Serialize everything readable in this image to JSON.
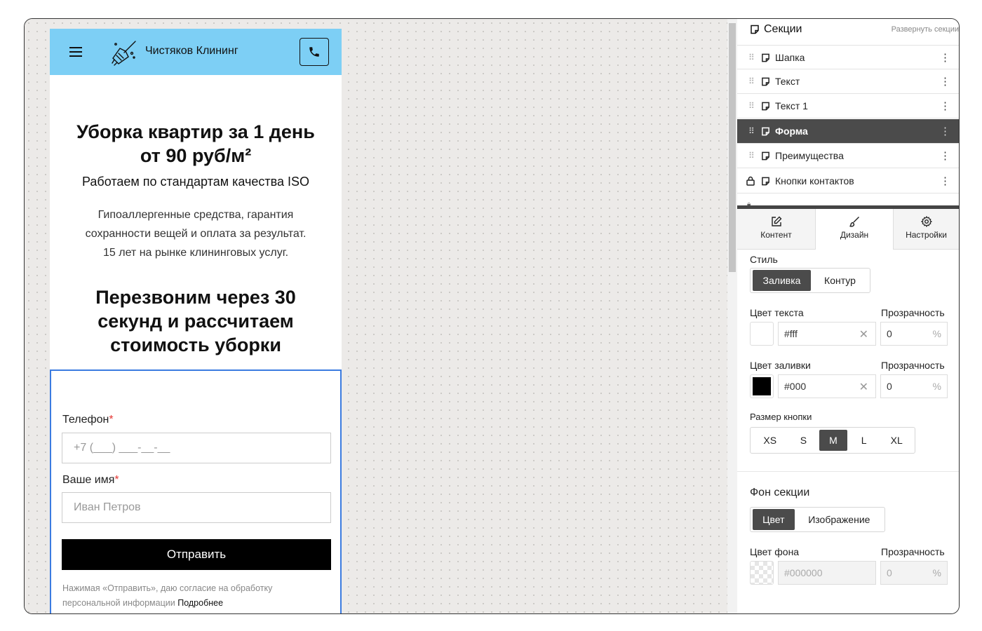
{
  "preview": {
    "brand": "Чистяков Клининг",
    "headline_line1": "Уборка квартир за 1 день",
    "headline_line2": "от 90 руб/м²",
    "subtitle": "Работаем по стандартам качества ISO",
    "description_line1": "Гипоаллергенные средства, гарантия",
    "description_line2": "сохранности вещей и оплата за результат.",
    "description_line3": "15 лет на рынке клининговых услуг.",
    "callback_line1": "Перезвоним через 30",
    "callback_line2": "секунд и рассчитаем",
    "callback_line3": "стоимость уборки",
    "form": {
      "phone_label": "Телефон",
      "phone_placeholder": "+7 (___) ___-__-__",
      "name_label": "Ваше имя",
      "name_placeholder": "Иван Петров",
      "required_mark": "*",
      "submit_label": "Отправить",
      "consent_text": "Нажимая «Отправить», даю согласие на обработку персональной информации",
      "consent_link": "Подробнее"
    }
  },
  "panel": {
    "sections_title": "Секции",
    "expand_label": "Развернуть секции",
    "sections": [
      {
        "label": "Шапка",
        "locked": false,
        "active": false
      },
      {
        "label": "Текст",
        "locked": false,
        "active": false
      },
      {
        "label": "Текст 1",
        "locked": false,
        "active": false
      },
      {
        "label": "Форма",
        "locked": false,
        "active": true
      },
      {
        "label": "Преимущества",
        "locked": false,
        "active": false
      },
      {
        "label": "Кнопки контактов",
        "locked": true,
        "active": false
      }
    ],
    "tabs": [
      {
        "label": "Контент",
        "icon": "edit-icon"
      },
      {
        "label": "Дизайн",
        "icon": "brush-icon"
      },
      {
        "label": "Настройки",
        "icon": "gear-icon"
      }
    ],
    "active_tab": "Дизайн",
    "design": {
      "style_label": "Стиль",
      "style_options": [
        "Заливка",
        "Контур"
      ],
      "style_selected": "Заливка",
      "text_color_label": "Цвет текста",
      "text_color_value": "#fff",
      "text_opacity_label": "Прозрачность",
      "text_opacity_value": "0",
      "fill_color_label": "Цвет заливки",
      "fill_color_value": "#000",
      "fill_opacity_label": "Прозрачность",
      "fill_opacity_value": "0",
      "button_size_label": "Размер кнопки",
      "button_sizes": [
        "XS",
        "S",
        "M",
        "L",
        "XL"
      ],
      "button_size_selected": "M",
      "section_bg_label": "Фон секции",
      "bg_options": [
        "Цвет",
        "Изображение"
      ],
      "bg_selected": "Цвет",
      "bg_color_label": "Цвет фона",
      "bg_color_value": "#000000",
      "bg_opacity_label": "Прозрачность",
      "bg_opacity_value": "0",
      "percent": "%"
    }
  },
  "colors": {
    "header_bg": "#7dcff5",
    "accent_border": "#3b7be0",
    "active_row": "#4b4b4b",
    "required": "#e53935"
  }
}
